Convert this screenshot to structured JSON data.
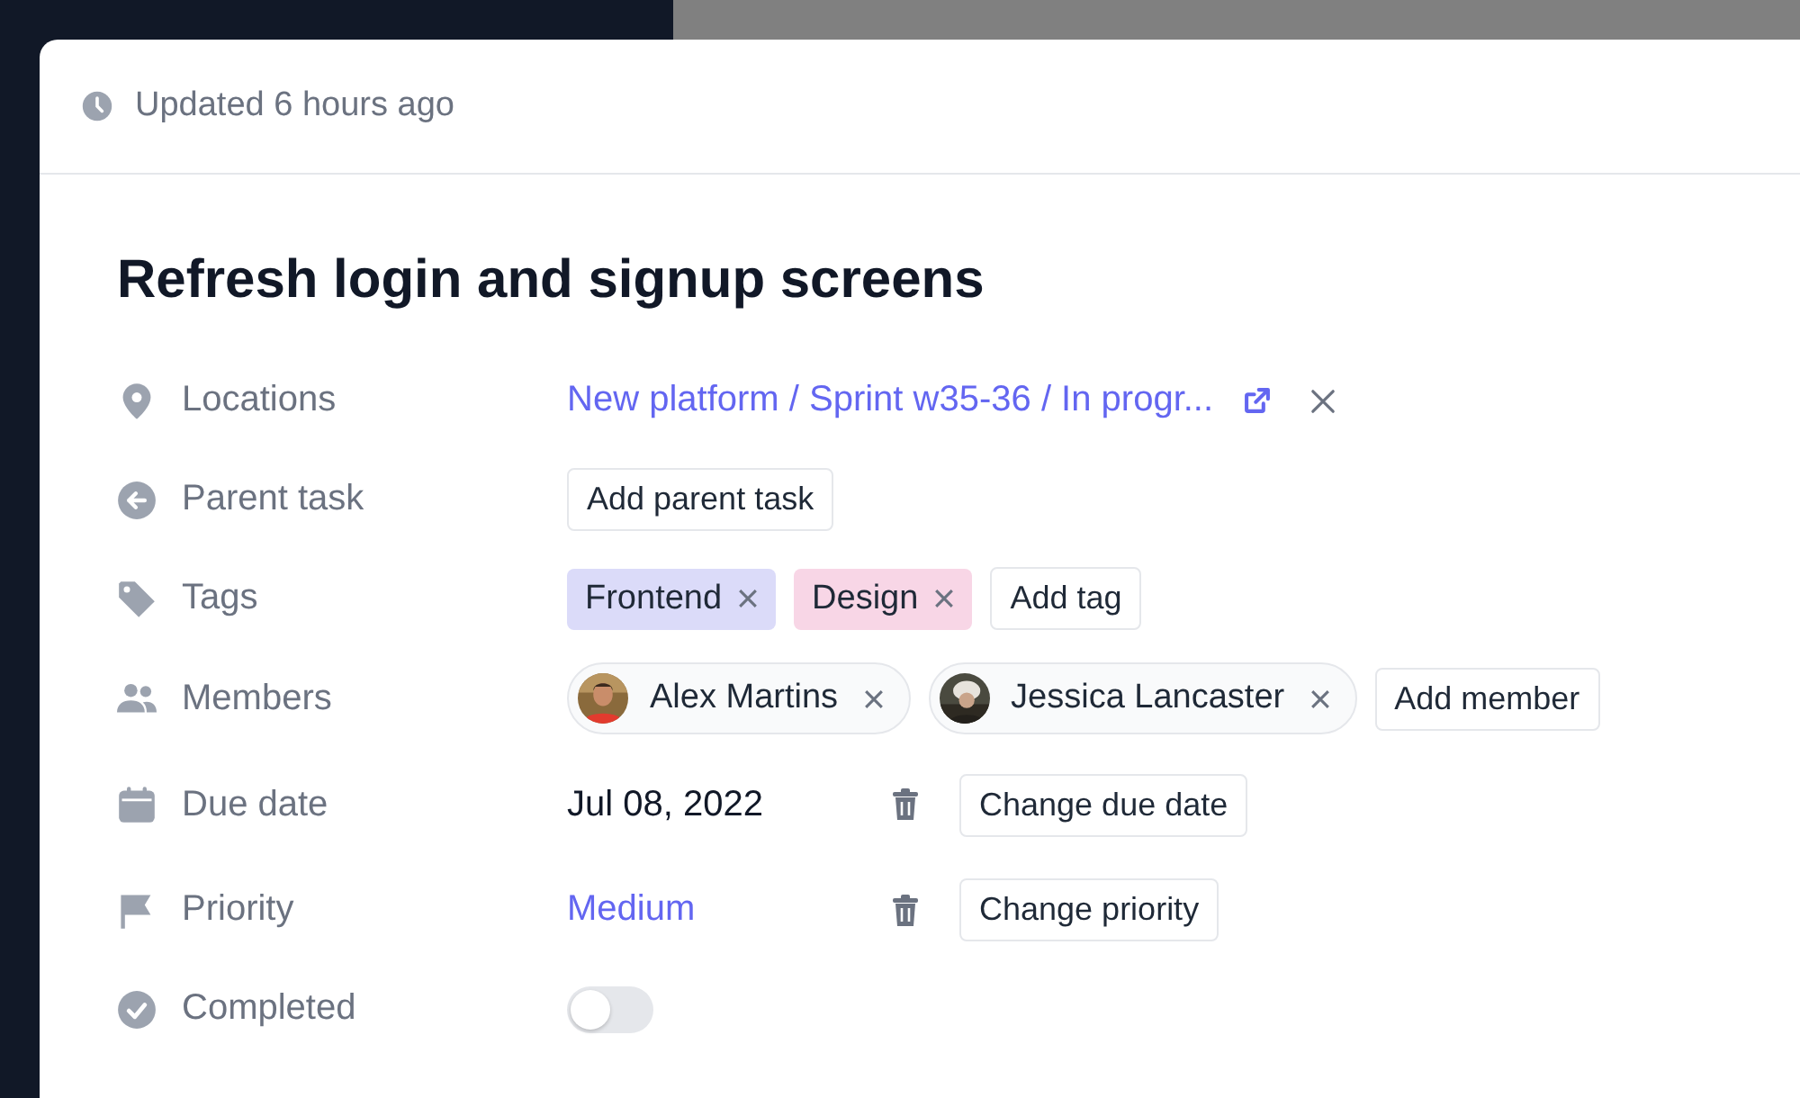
{
  "updated": "Updated 6 hours ago",
  "title": "Refresh login and signup screens",
  "properties": [
    {
      "kind": "link",
      "label": "Locations",
      "value": "New platform / Sprint w35-36 / In progr..."
    },
    {
      "kind": "button",
      "label": "Parent task",
      "button": "Add parent task"
    },
    {
      "kind": "tags",
      "label": "Tags",
      "tags": [
        {
          "label": "Frontend",
          "color": "#dbdbf9"
        },
        {
          "label": "Design",
          "color": "#f8d6e6"
        }
      ],
      "button": "Add tag"
    },
    {
      "kind": "members",
      "label": "Members",
      "members": [
        {
          "name": "Alex Martins"
        },
        {
          "name": "Jessica Lancaster"
        }
      ],
      "button": "Add member"
    },
    {
      "kind": "date",
      "label": "Due date",
      "value": "Jul 08, 2022",
      "button": "Change due date"
    },
    {
      "kind": "priority",
      "label": "Priority",
      "value": "Medium",
      "button": "Change priority"
    },
    {
      "kind": "toggle",
      "label": "Completed",
      "on": false
    }
  ]
}
